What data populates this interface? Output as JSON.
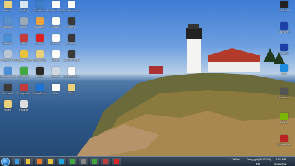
{
  "desktop": {
    "left_icons": [
      {
        "label": "Admin",
        "icon": "user-folder-icon",
        "color": "#e8d17a"
      },
      {
        "label": "Ondrej",
        "icon": "document-icon",
        "color": "#d9e6f5"
      },
      {
        "label": "Nahrávac",
        "icon": "app-icon",
        "color": "#3c7fc8"
      },
      {
        "label": "Fix Ihre IP test",
        "icon": "document-icon",
        "color": "#ffffff"
      },
      {
        "label": "Fix Spec cap est",
        "icon": "document-icon",
        "color": "#ffffff"
      },
      {
        "label": "Computer",
        "icon": "computer-icon",
        "color": "#5a8fc9"
      },
      {
        "label": "Utility",
        "icon": "utility-icon",
        "color": "#9aa8b8"
      },
      {
        "label": "Manager",
        "icon": "manager-icon",
        "color": "#f0a23c"
      },
      {
        "label": "Sestava",
        "icon": "document-icon",
        "color": "#ffffff"
      },
      {
        "label": "Sdílená",
        "icon": "monitor-icon",
        "color": "#3a3a3a"
      },
      {
        "label": "Network",
        "icon": "network-icon",
        "color": "#4d8fd6"
      },
      {
        "label": "Ultra",
        "icon": "app-icon",
        "color": "#c63b3b"
      },
      {
        "label": "Launch",
        "icon": "power-icon",
        "color": "#d22"
      },
      {
        "label": "Soubory",
        "icon": "document-icon",
        "color": "#ffffff"
      },
      {
        "label": "Sestava",
        "icon": "monitor-icon",
        "color": "#3a3a3a"
      },
      {
        "label": "Recycle Bin",
        "icon": "recycle-bin-icon",
        "color": "#b8c6d6"
      },
      {
        "label": "Google Chrome",
        "icon": "chrome-icon",
        "color": "#e8c23a"
      },
      {
        "label": "Multimedia",
        "icon": "folder-icon",
        "color": "#e8d17a"
      },
      {
        "label": "Daniel",
        "icon": "document-icon",
        "color": "#ffffff"
      },
      {
        "label": "Ae.WMV.mp4",
        "icon": "video-icon",
        "color": "#3a3a3a"
      },
      {
        "label": "Control Panel",
        "icon": "control-panel-icon",
        "color": "#4d8fd6"
      },
      {
        "label": "CCleaner",
        "icon": "ccleaner-icon",
        "color": "#3fa83f"
      },
      {
        "label": "Utility",
        "icon": "monitor-icon",
        "color": "#2a2a2a"
      },
      {
        "label": "Screen",
        "icon": "bar-icon",
        "color": "#cfd8e2"
      },
      {
        "label": "Gru Zoznam",
        "icon": "document-icon",
        "color": "#ffffff"
      },
      {
        "label": "Uninstall",
        "icon": "app-icon",
        "color": "#3a3a3a"
      },
      {
        "label": "Fotografie",
        "icon": "app-icon",
        "color": "#c23a3a"
      },
      {
        "label": "TeamViewer",
        "icon": "teamviewer-icon",
        "color": "#1e73d6"
      },
      {
        "label": "Totis",
        "icon": "document-icon",
        "color": "#ffffff"
      },
      {
        "label": "Fox",
        "icon": "folder-icon",
        "color": "#e8d17a"
      },
      {
        "label": "Video",
        "icon": "folder-icon",
        "color": "#e8d17a"
      },
      {
        "label": "Hudba",
        "icon": "webcam-icon",
        "color": "#ddd"
      }
    ],
    "right_icons": [
      {
        "label": "F1 2015",
        "icon": "game-icon",
        "color": "#222"
      },
      {
        "label": "Launcher",
        "icon": "game-icon",
        "color": "#1d3fa8"
      },
      {
        "label": "League",
        "icon": "game-icon",
        "color": "#1d3fa8"
      },
      {
        "label": "Zalo",
        "icon": "zalo-icon",
        "color": "#1e8ce0"
      },
      {
        "label": "Settings",
        "icon": "settings-icon",
        "color": "#555"
      },
      {
        "label": "NVIDIA",
        "icon": "nvidia-icon",
        "color": "#7ab800"
      },
      {
        "label": "Battle Rec",
        "icon": "app-icon",
        "color": "#b22"
      }
    ]
  },
  "taskbar": {
    "pinned": [
      {
        "label": "Internet Explorer",
        "icon": "ie-icon",
        "color": "#3a9be8"
      },
      {
        "label": "File Explorer",
        "icon": "explorer-icon",
        "color": "#e8c23a"
      },
      {
        "label": "Media Player",
        "icon": "media-icon",
        "color": "#e87a2a"
      },
      {
        "label": "Chrome",
        "icon": "chrome-icon",
        "color": "#e8c23a"
      },
      {
        "label": "Skype",
        "icon": "skype-icon",
        "color": "#1ea7e0"
      },
      {
        "label": "CCleaner",
        "icon": "ccleaner-icon",
        "color": "#3fa83f"
      },
      {
        "label": "Tool",
        "icon": "tool-icon",
        "color": "#888"
      },
      {
        "label": "Camtasia",
        "icon": "camtasia-icon",
        "color": "#3fa83f"
      },
      {
        "label": "App",
        "icon": "app-icon",
        "color": "#c23a3a"
      },
      {
        "label": "Recorder",
        "icon": "record-icon",
        "color": "#d22"
      }
    ],
    "tray_speed": "1.3KB/s",
    "tray_text": "Đang ghi (00:00:05)",
    "language": "EN",
    "time": "5:33 PM",
    "date": "4/26/2021"
  }
}
